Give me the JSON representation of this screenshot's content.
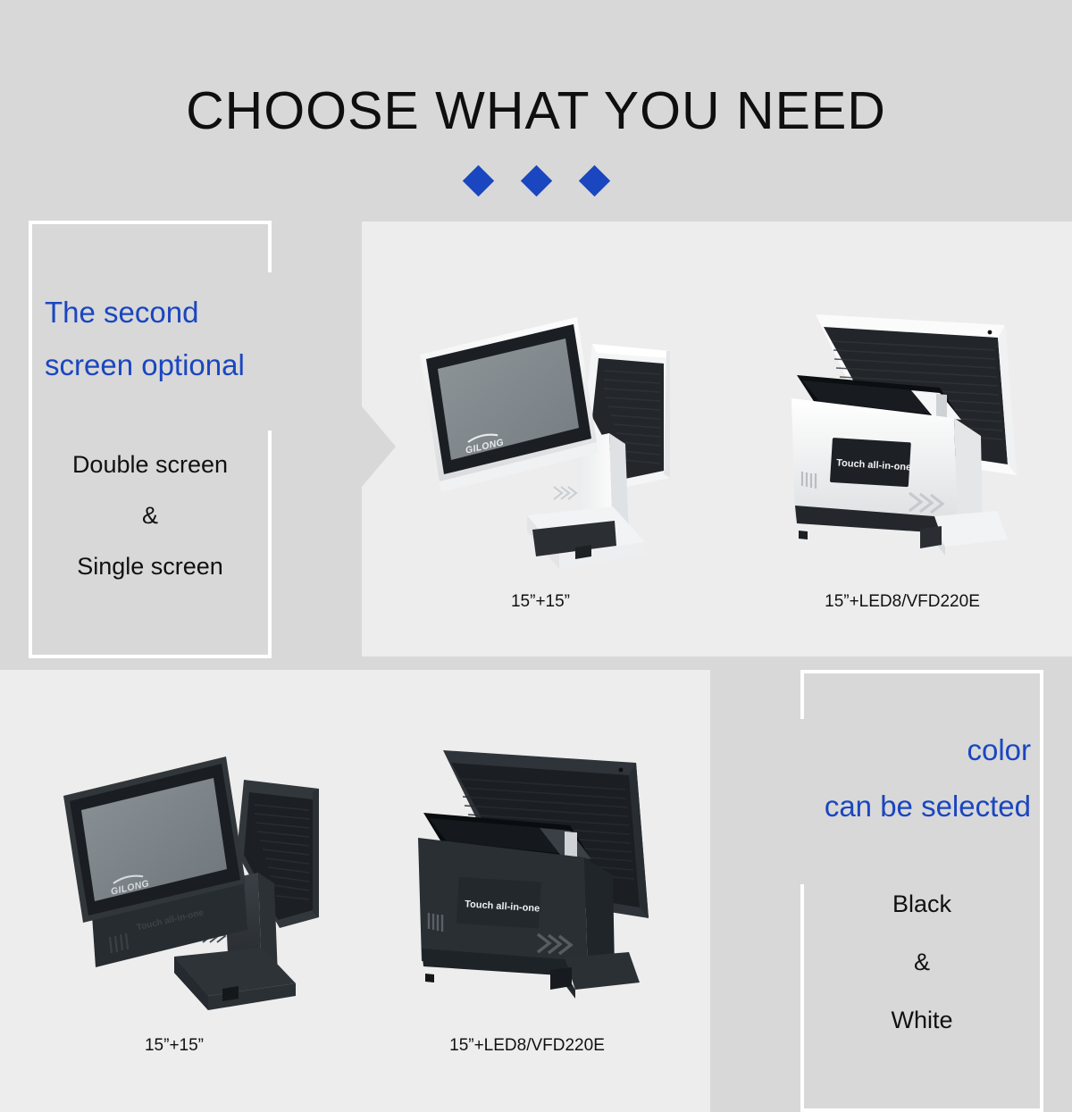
{
  "header": {
    "title": "CHOOSE WHAT YOU NEED",
    "diamond_count": 3,
    "accent_color": "#1a46c0"
  },
  "top_left_panel": {
    "heading_line1": "The second",
    "heading_line2": "screen optional",
    "sub_line1": "Double screen",
    "sub_line2": "&",
    "sub_line3": "Single screen"
  },
  "bottom_right_panel": {
    "heading_line1": "color",
    "heading_line2": "can be selected",
    "sub_line1": "Black",
    "sub_line2": "&",
    "sub_line3": "White"
  },
  "products": {
    "top": [
      {
        "caption": "15”+15”",
        "color": "white",
        "view": "front",
        "brand": "GILONG"
      },
      {
        "caption": "15”+LED8/VFD220E",
        "color": "white",
        "view": "rear",
        "badge": "Touch all-in-one"
      }
    ],
    "bottom": [
      {
        "caption": "15”+15”",
        "color": "black",
        "view": "front",
        "brand": "GILONG",
        "badge": "Touch all-in-one"
      },
      {
        "caption": "15”+LED8/VFD220E",
        "color": "black",
        "view": "rear",
        "badge": "Touch all-in-one"
      }
    ]
  },
  "colors": {
    "background": "#d8d8d8",
    "panel": "#ededed",
    "accent": "#1a46c0",
    "text": "#111111",
    "border": "#ffffff"
  }
}
